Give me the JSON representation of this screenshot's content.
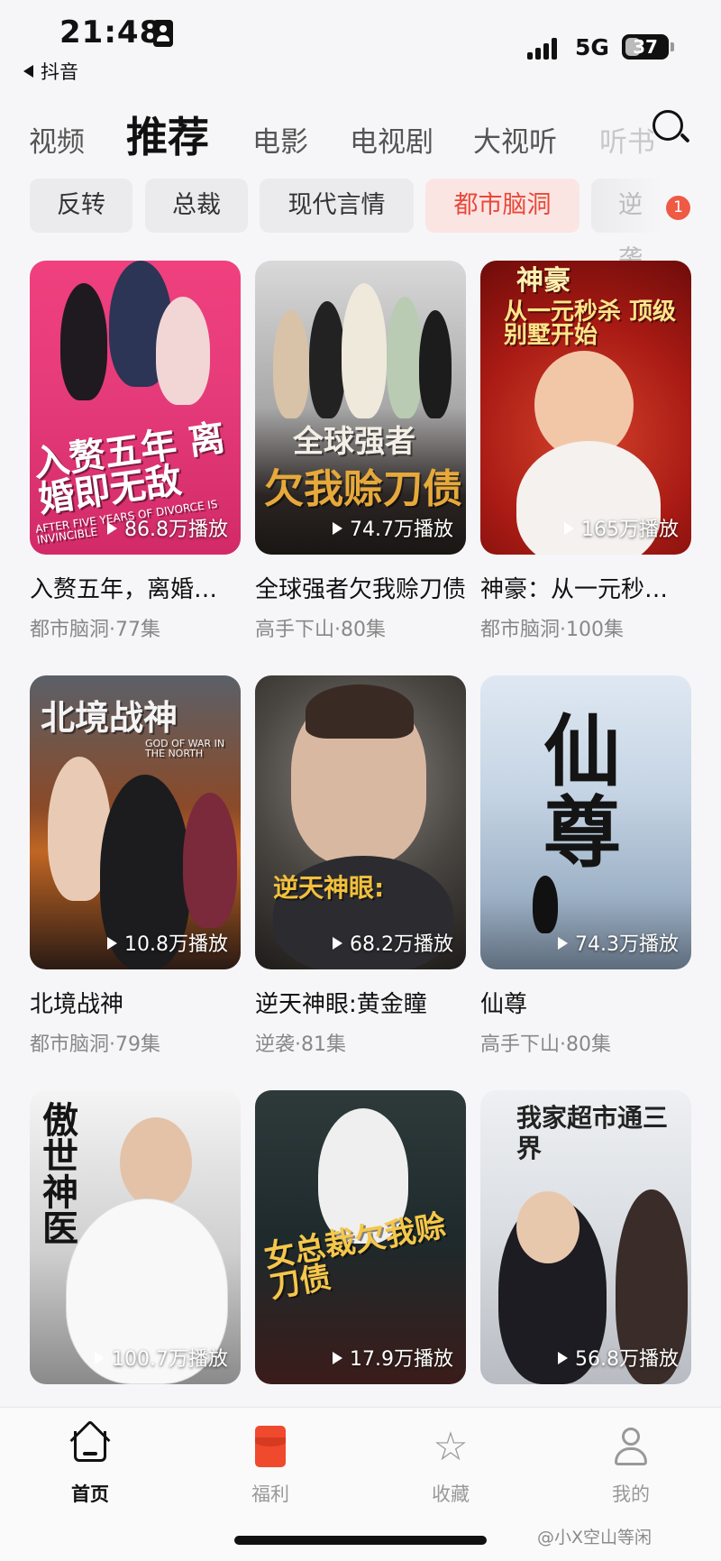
{
  "status_bar": {
    "time": "21:48",
    "back_app": "抖音",
    "network": "5G",
    "battery": "37",
    "battery_level": 0.37
  },
  "top_tabs": [
    "视频",
    "推荐",
    "电影",
    "电视剧",
    "大视听",
    "听书"
  ],
  "active_tab": "推荐",
  "chips": [
    "反转",
    "总裁",
    "现代言情",
    "都市脑洞",
    "逆袭"
  ],
  "active_chip": "都市脑洞",
  "chip_badge": "1",
  "cards": [
    {
      "title": "入赘五年，离婚即无敌",
      "meta": "都市脑洞·77集",
      "plays": "86.8万播放",
      "poster_text": "入赘五年 离婚即无敌",
      "poster_subtext": "AFTER FIVE YEARS OF DIVORCE IS INVINCIBLE"
    },
    {
      "title": "全球强者欠我赊刀债",
      "meta": "高手下山·80集",
      "plays": "74.7万播放",
      "poster_text": "全球强者",
      "poster_subtext": "欠我赊刀债"
    },
    {
      "title": "神豪：从一元秒杀顶级别墅开始",
      "meta": "都市脑洞·100集",
      "plays": "165万播放",
      "poster_text": "神豪",
      "poster_subtext": "从一元秒杀 顶级别墅开始"
    },
    {
      "title": "北境战神",
      "meta": "都市脑洞·79集",
      "plays": "10.8万播放",
      "poster_text": "北境战神",
      "poster_subtext": "GOD OF WAR IN THE NORTH"
    },
    {
      "title": "逆天神眼:黄金瞳",
      "meta": "逆袭·81集",
      "plays": "68.2万播放",
      "poster_text": "逆天神眼:",
      "poster_subtext": ""
    },
    {
      "title": "仙尊",
      "meta": "高手下山·80集",
      "plays": "74.3万播放",
      "poster_text": "仙尊",
      "poster_subtext": ""
    },
    {
      "title": "",
      "meta": "",
      "plays": "100.7万播放",
      "poster_text": "傲世神医",
      "poster_subtext": ""
    },
    {
      "title": "",
      "meta": "",
      "plays": "17.9万播放",
      "poster_text": "女总裁欠我赊刀债",
      "poster_subtext": ""
    },
    {
      "title": "",
      "meta": "",
      "plays": "56.8万播放",
      "poster_text": "我家超市通三界",
      "poster_subtext": ""
    }
  ],
  "bottom_nav": [
    {
      "label": "首页",
      "icon": "home-icon",
      "active": true
    },
    {
      "label": "福利",
      "icon": "red-packet-icon",
      "active": false
    },
    {
      "label": "收藏",
      "icon": "star-icon",
      "active": false
    },
    {
      "label": "我的",
      "icon": "profile-icon",
      "active": false
    }
  ],
  "watermark": "@小X空山等闲",
  "colors": {
    "accent": "#e8493a",
    "badge": "#ee5a44",
    "active_chip_bg": "#fbe5e3"
  }
}
